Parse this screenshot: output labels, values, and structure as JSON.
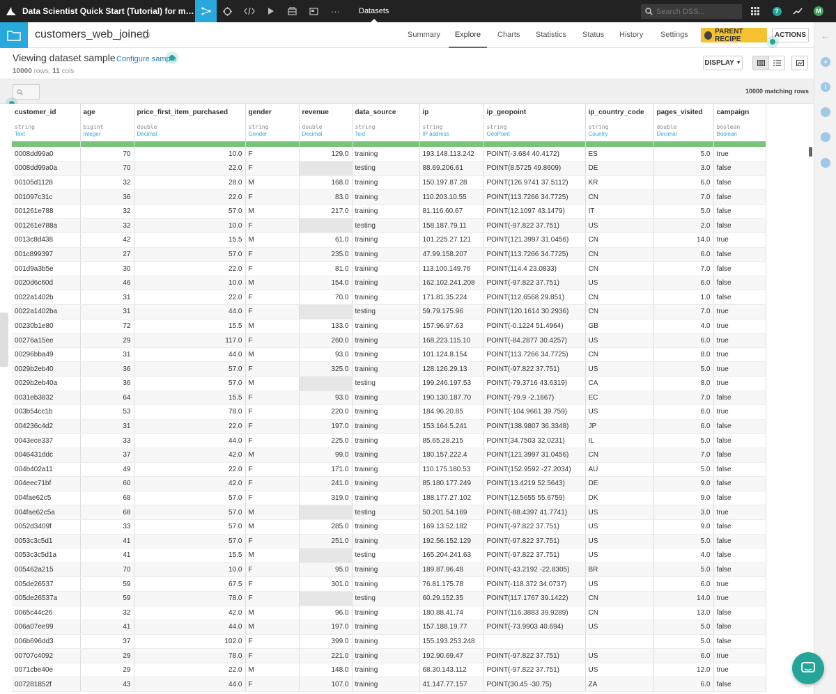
{
  "topbar": {
    "project_title": "Data Scientist Quick Start (Tutorial) for ma...",
    "section_label": "Datasets",
    "search_placeholder": "Search DSS...",
    "avatar_letter": "M",
    "nav_icons": [
      "flow-icon",
      "code-icon",
      "code-brackets-icon",
      "play-icon",
      "jobs-icon",
      "dashboard-icon",
      "more-icon"
    ]
  },
  "dataset": {
    "name": "customers_web_joined",
    "tabs": [
      "Summary",
      "Explore",
      "Charts",
      "Statistics",
      "Status",
      "History",
      "Settings"
    ],
    "active_tab": "Explore",
    "parent_recipe_label": "PARENT RECIPE",
    "actions_label": "ACTIONS"
  },
  "sample": {
    "title": "Viewing dataset sample",
    "configure_label": "Configure sample",
    "rows_count": "10000",
    "rows_label": "rows,",
    "cols_count": "11",
    "cols_label": "cols",
    "display_label": "DISPLAY"
  },
  "filter": {
    "matching_text": "10000 matching rows"
  },
  "colors": {
    "accent": "#28a9dd",
    "recipe": "#f4c130",
    "valid_bar": "#79c478",
    "beacon": "#25a59a"
  },
  "columns": [
    {
      "name": "customer_id",
      "type": "string",
      "meaning": "Text"
    },
    {
      "name": "age",
      "type": "bigint",
      "meaning": "Integer"
    },
    {
      "name": "price_first_item_purchased",
      "type": "double",
      "meaning": "Decimal"
    },
    {
      "name": "gender",
      "type": "string",
      "meaning": "Gender"
    },
    {
      "name": "revenue",
      "type": "double",
      "meaning": "Decimal"
    },
    {
      "name": "data_source",
      "type": "string",
      "meaning": "Text"
    },
    {
      "name": "ip",
      "type": "string",
      "meaning": "IP address"
    },
    {
      "name": "ip_geopoint",
      "type": "string",
      "meaning": "GeoPoint"
    },
    {
      "name": "ip_country_code",
      "type": "string",
      "meaning": "Country"
    },
    {
      "name": "pages_visited",
      "type": "double",
      "meaning": "Decimal"
    },
    {
      "name": "campaign",
      "type": "boolean",
      "meaning": "Boolean"
    }
  ],
  "rows": [
    [
      "0008dd99a0",
      "70",
      "10.0",
      "F",
      "129.0",
      "training",
      "193.148.113.242",
      "POINT(-3.684 40.4172)",
      "ES",
      "5.0",
      "true"
    ],
    [
      "0008dd99a0a",
      "70",
      "22.0",
      "F",
      "",
      "testing",
      "88.69.206.61",
      "POINT(8.5725 49.8609)",
      "DE",
      "3.0",
      "false"
    ],
    [
      "00105d1128",
      "32",
      "28.0",
      "M",
      "168.0",
      "training",
      "150.197.87.28",
      "POINT(126.9741 37.5112)",
      "KR",
      "6.0",
      "false"
    ],
    [
      "001097c31c",
      "36",
      "22.0",
      "F",
      "83.0",
      "training",
      "110.203.10.55",
      "POINT(113.7266 34.7725)",
      "CN",
      "7.0",
      "false"
    ],
    [
      "001261e788",
      "32",
      "57.0",
      "M",
      "217.0",
      "training",
      "81.116.60.67",
      "POINT(12.1097 43.1479)",
      "IT",
      "5.0",
      "false"
    ],
    [
      "001261e788a",
      "32",
      "10.0",
      "F",
      "",
      "testing",
      "158.187.79.11",
      "POINT(-97.822 37.751)",
      "US",
      "2.0",
      "false"
    ],
    [
      "0013c8d438",
      "42",
      "15.5",
      "M",
      "61.0",
      "training",
      "101.225.27.121",
      "POINT(121.3997 31.0456)",
      "CN",
      "14.0",
      "true"
    ],
    [
      "001c899397",
      "27",
      "57.0",
      "F",
      "235.0",
      "training",
      "47.99.158.207",
      "POINT(113.7266 34.7725)",
      "CN",
      "6.0",
      "false"
    ],
    [
      "001d9a3b5e",
      "30",
      "22.0",
      "F",
      "81.0",
      "training",
      "113.100.149.76",
      "POINT(114.4 23.0833)",
      "CN",
      "7.0",
      "false"
    ],
    [
      "0020d6c60d",
      "46",
      "10.0",
      "M",
      "154.0",
      "training",
      "162.102.241.208",
      "POINT(-97.822 37.751)",
      "US",
      "6.0",
      "false"
    ],
    [
      "0022a1402b",
      "31",
      "22.0",
      "F",
      "70.0",
      "training",
      "171.81.35.224",
      "POINT(112.6568 29.851)",
      "CN",
      "1.0",
      "false"
    ],
    [
      "0022a1402ba",
      "31",
      "44.0",
      "F",
      "",
      "testing",
      "59.79.175.96",
      "POINT(120.1614 30.2936)",
      "CN",
      "7.0",
      "true"
    ],
    [
      "00230b1e80",
      "72",
      "15.5",
      "M",
      "133.0",
      "training",
      "157.96.97.63",
      "POINT(-0.1224 51.4964)",
      "GB",
      "4.0",
      "true"
    ],
    [
      "00276a15ee",
      "29",
      "117.0",
      "F",
      "260.0",
      "training",
      "168.223.115.10",
      "POINT(-84.2877 30.4257)",
      "US",
      "6.0",
      "true"
    ],
    [
      "00296bba49",
      "31",
      "44.0",
      "M",
      "93.0",
      "training",
      "101.124.8.154",
      "POINT(113.7266 34.7725)",
      "CN",
      "8.0",
      "true"
    ],
    [
      "0029b2eb40",
      "36",
      "57.0",
      "F",
      "325.0",
      "training",
      "128.126.29.13",
      "POINT(-97.822 37.751)",
      "US",
      "5.0",
      "true"
    ],
    [
      "0029b2eb40a",
      "36",
      "57.0",
      "M",
      "",
      "testing",
      "199.246.197.53",
      "POINT(-79.3716 43.6319)",
      "CA",
      "8.0",
      "true"
    ],
    [
      "0031eb3832",
      "64",
      "15.5",
      "F",
      "93.0",
      "training",
      "190.130.187.70",
      "POINT(-79.9 -2.1667)",
      "EC",
      "7.0",
      "false"
    ],
    [
      "003b54cc1b",
      "53",
      "78.0",
      "F",
      "220.0",
      "training",
      "184.96.20.85",
      "POINT(-104.9661 39.759)",
      "US",
      "6.0",
      "true"
    ],
    [
      "004236c4d2",
      "31",
      "22.0",
      "F",
      "197.0",
      "training",
      "153.164.5.241",
      "POINT(138.9807 36.3348)",
      "JP",
      "6.0",
      "false"
    ],
    [
      "0043ece337",
      "33",
      "44.0",
      "F",
      "225.0",
      "training",
      "85.65.28.215",
      "POINT(34.7503 32.0231)",
      "IL",
      "5.0",
      "false"
    ],
    [
      "0046431ddc",
      "37",
      "42.0",
      "M",
      "99.0",
      "training",
      "180.157.222.4",
      "POINT(121.3997 31.0456)",
      "CN",
      "7.0",
      "false"
    ],
    [
      "004b402a11",
      "49",
      "22.0",
      "F",
      "171.0",
      "training",
      "110.175.180.53",
      "POINT(152.9592 -27.2034)",
      "AU",
      "5.0",
      "false"
    ],
    [
      "004eec71bf",
      "60",
      "42.0",
      "F",
      "241.0",
      "training",
      "85.180.177.249",
      "POINT(13.4219 52.5643)",
      "DE",
      "9.0",
      "false"
    ],
    [
      "004fae62c5",
      "68",
      "57.0",
      "F",
      "319.0",
      "training",
      "188.177.27.102",
      "POINT(12.5655 55.6759)",
      "DK",
      "9.0",
      "false"
    ],
    [
      "004fae62c5a",
      "68",
      "57.0",
      "M",
      "",
      "testing",
      "50.201.54.169",
      "POINT(-88.4397 41.7741)",
      "US",
      "3.0",
      "true"
    ],
    [
      "0052d3409f",
      "33",
      "57.0",
      "M",
      "285.0",
      "training",
      "169.13.52.182",
      "POINT(-97.822 37.751)",
      "US",
      "9.0",
      "false"
    ],
    [
      "0053c3c5d1",
      "41",
      "57.0",
      "F",
      "251.0",
      "training",
      "192.56.152.129",
      "POINT(-97.822 37.751)",
      "US",
      "5.0",
      "false"
    ],
    [
      "0053c3c5d1a",
      "41",
      "15.5",
      "M",
      "",
      "testing",
      "165.204.241.63",
      "POINT(-97.822 37.751)",
      "US",
      "4.0",
      "false"
    ],
    [
      "005462a215",
      "70",
      "10.0",
      "F",
      "95.0",
      "training",
      "189.87.96.48",
      "POINT(-43.2192 -22.8305)",
      "BR",
      "5.0",
      "false"
    ],
    [
      "005de26537",
      "59",
      "67.5",
      "F",
      "301.0",
      "training",
      "76.81.175.78",
      "POINT(-118.372 34.0737)",
      "US",
      "6.0",
      "true"
    ],
    [
      "005de26537a",
      "59",
      "78.0",
      "F",
      "",
      "testing",
      "60.29.152.35",
      "POINT(117.1767 39.1422)",
      "CN",
      "14.0",
      "true"
    ],
    [
      "0065c44c26",
      "32",
      "42.0",
      "M",
      "96.0",
      "training",
      "180.88.41.74",
      "POINT(116.3883 39.9289)",
      "CN",
      "13.0",
      "false"
    ],
    [
      "006a07ee99",
      "41",
      "44.0",
      "M",
      "197.0",
      "training",
      "157.188.19.77",
      "POINT(-73.9903 40.694)",
      "US",
      "5.0",
      "false"
    ],
    [
      "006b696dd3",
      "37",
      "102.0",
      "F",
      "399.0",
      "training",
      "155.193.253.248",
      "",
      "",
      "5.0",
      "false"
    ],
    [
      "00707c4092",
      "29",
      "78.0",
      "F",
      "221.0",
      "training",
      "192.90.69.47",
      "POINT(-97.822 37.751)",
      "US",
      "6.0",
      "true"
    ],
    [
      "0071cbe40e",
      "29",
      "22.0",
      "M",
      "148.0",
      "training",
      "68.30.143.112",
      "POINT(-97.822 37.751)",
      "US",
      "12.0",
      "true"
    ],
    [
      "007281852f",
      "43",
      "44.0",
      "F",
      "107.0",
      "training",
      "41.147.77.157",
      "POINT(30.45 -30.75)",
      "ZA",
      "6.0",
      "false"
    ]
  ]
}
